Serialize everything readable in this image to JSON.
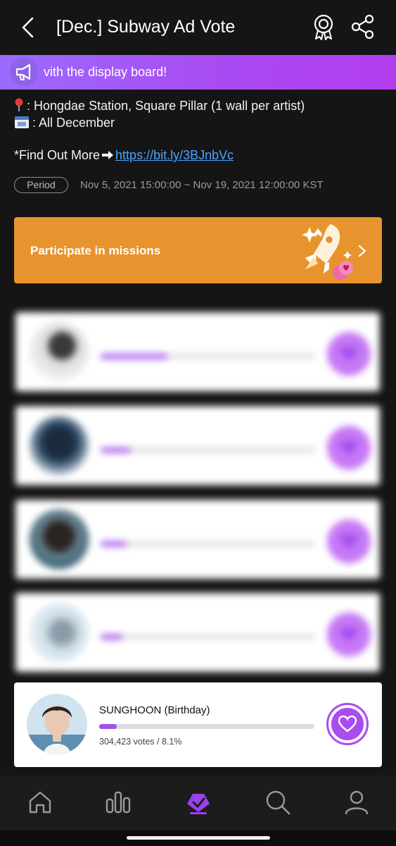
{
  "header": {
    "title": "[Dec.] Subway Ad Vote"
  },
  "banner": {
    "text": "vith the display board!"
  },
  "info": {
    "location": ": Hongdae Station, Square Pillar (1 wall per artist)",
    "dates": ": All December",
    "find_more_prefix": "*Find Out More",
    "find_more_link": "https://bit.ly/3BJnbVc"
  },
  "period": {
    "label": "Period",
    "dates": "Nov 5, 2021 15:00:00 ~ Nov 19, 2021 12:00:00 KST"
  },
  "mission": {
    "label": "Participate in missions"
  },
  "candidates_blurred": [
    {
      "name": "",
      "votes": "",
      "percent": 31
    },
    {
      "name": "",
      "votes": "",
      "percent": 14
    },
    {
      "name": "",
      "votes": "",
      "percent": 12
    },
    {
      "name": "",
      "votes": "",
      "percent": 10
    }
  ],
  "my_candidate": {
    "name": "SUNGHOON (Birthday)",
    "votes": "304,423 votes / 8.1%",
    "percent": 8.1
  },
  "colors": {
    "accent": "#a94cf0",
    "mission": "#e8942e",
    "link": "#4aa3ff"
  },
  "tabs": [
    "home-icon",
    "chart-icon",
    "vote-icon",
    "search-icon",
    "profile-icon"
  ]
}
